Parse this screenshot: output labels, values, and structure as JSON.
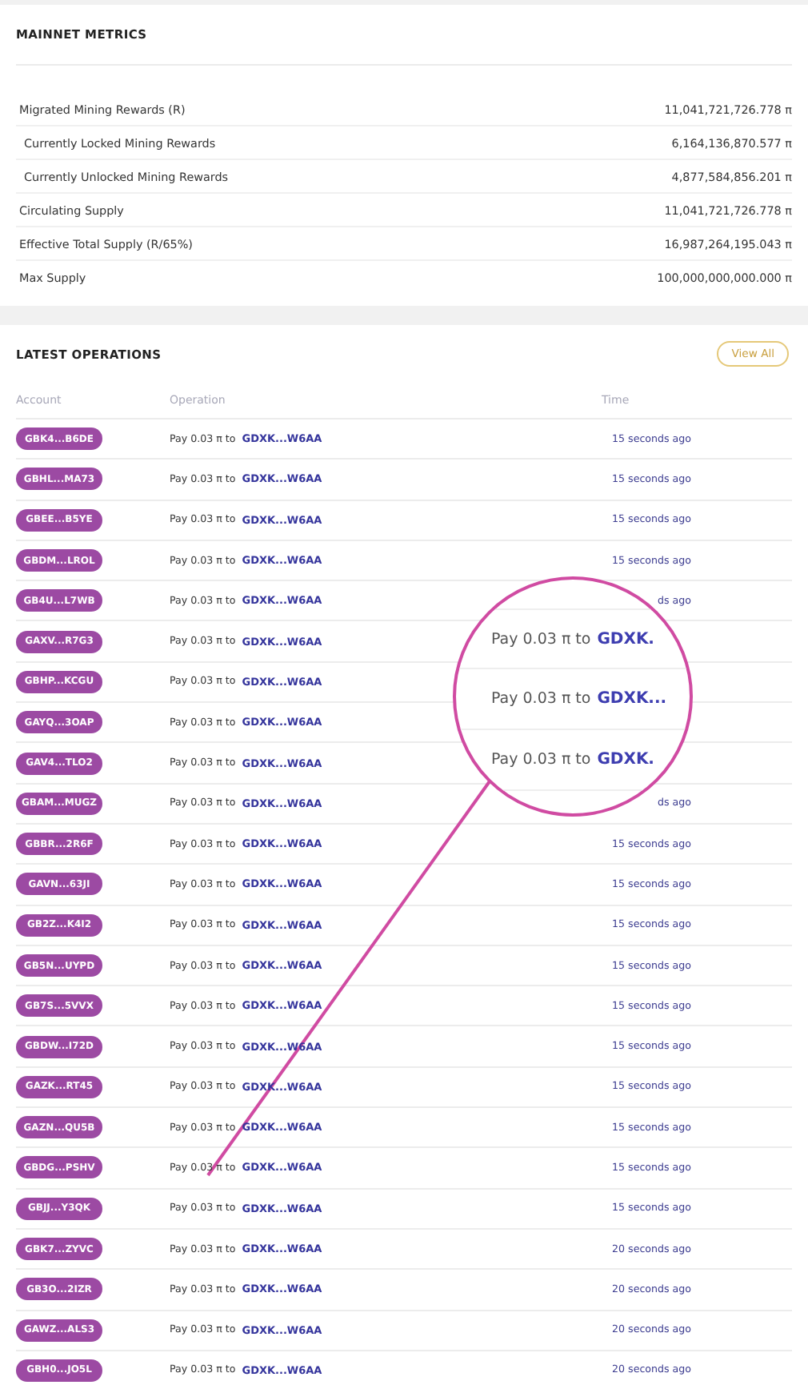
{
  "metrics": {
    "title": "MAINNET METRICS",
    "rows": [
      {
        "kind": "main",
        "label": "Migrated Mining Rewards (R)",
        "value": "11,041,721,726.778 π"
      },
      {
        "kind": "sub",
        "label": "Currently Locked Mining Rewards",
        "value": "6,164,136,870.577 π"
      },
      {
        "kind": "sub",
        "label": "Currently Unlocked Mining Rewards",
        "value": "4,877,584,856.201 π"
      },
      {
        "kind": "main",
        "label": "Circulating Supply",
        "value": "11,041,721,726.778 π"
      },
      {
        "kind": "main",
        "label": "Effective Total Supply (R/65%)",
        "value": "16,987,264,195.043 π"
      },
      {
        "kind": "main",
        "label": "Max Supply",
        "value": "100,000,000,000.000 π"
      }
    ]
  },
  "operations": {
    "title": "LATEST OPERATIONS",
    "view_all": "View All",
    "columns": [
      "Account",
      "Operation",
      "Time"
    ],
    "rows": [
      {
        "account": "GBK4...B6DE",
        "text": "Pay 0.03 π to",
        "link": "GDXK...W6AA",
        "time": "15 seconds ago"
      },
      {
        "account": "GBHL...MA73",
        "text": "Pay 0.03 π to",
        "link": "GDXK...W6AA",
        "time": "15 seconds ago"
      },
      {
        "account": "GBEE...B5YE",
        "text": "Pay 0.03 π to",
        "link": "GDXK...W6AA",
        "time": "15 seconds ago"
      },
      {
        "account": "GBDM...LROL",
        "text": "Pay 0.03 π to",
        "link": "GDXK...W6AA",
        "time": "15 seconds ago"
      },
      {
        "account": "GB4U...L7WB",
        "text": "Pay 0.03 π to",
        "link": "GDXK...W6AA",
        "time": "ds ago"
      },
      {
        "account": "GAXV...R7G3",
        "text": "Pay 0.03 π to",
        "link": "GDXK...W6AA"
      },
      {
        "account": "GBHP...KCGU",
        "text": "Pay 0.03 π to",
        "link": "GDXK...W6AA"
      },
      {
        "account": "GAYQ...3OAP",
        "text": "Pay 0.03 π to",
        "link": "GDXK...W6AA"
      },
      {
        "account": "GAV4...TLO2",
        "text": "Pay 0.03 π to",
        "link": "GDXK...W6AA"
      },
      {
        "account": "GBAM...MUGZ",
        "text": "Pay 0.03 π to",
        "link": "GDXK...W6AA",
        "time": "ds ago"
      },
      {
        "account": "GBBR...2R6F",
        "text": "Pay 0.03 π to",
        "link": "GDXK...W6AA",
        "time": "15 seconds ago"
      },
      {
        "account": "GAVN...63JI",
        "text": "Pay 0.03 π to",
        "link": "GDXK...W6AA",
        "time": "15 seconds ago"
      },
      {
        "account": "GB2Z...K4I2",
        "text": "Pay 0.03 π to",
        "link": "GDXK...W6AA",
        "time": "15 seconds ago"
      },
      {
        "account": "GB5N...UYPD",
        "text": "Pay 0.03 π to",
        "link": "GDXK...W6AA",
        "time": "15 seconds ago"
      },
      {
        "account": "GB7S...5VVX",
        "text": "Pay 0.03 π to",
        "link": "GDXK...W6AA",
        "time": "15 seconds ago"
      },
      {
        "account": "GBDW...I72D",
        "text": "Pay 0.03 π to",
        "link": "GDXK...W6AA",
        "time": "15 seconds ago"
      },
      {
        "account": "GAZK...RT45",
        "text": "Pay 0.03 π to",
        "link": "GDXK...W6AA",
        "time": "15 seconds ago"
      },
      {
        "account": "GAZN...QU5B",
        "text": "Pay 0.03 π to",
        "link": "GDXK...W6AA",
        "time": "15 seconds ago"
      },
      {
        "account": "GBDG...PSHV",
        "text": "Pay 0.03 π to",
        "link": "GDXK...W6AA",
        "time": "15 seconds ago"
      },
      {
        "account": "GBJJ...Y3QK",
        "text": "Pay 0.03 π to",
        "link": "GDXK...W6AA",
        "time": "15 seconds ago"
      },
      {
        "account": "GBK7...ZYVC",
        "text": "Pay 0.03 π to",
        "link": "GDXK...W6AA",
        "time": "20 seconds ago"
      },
      {
        "account": "GB3O...2IZR",
        "text": "Pay 0.03 π to",
        "link": "GDXK...W6AA",
        "time": "20 seconds ago"
      },
      {
        "account": "GAWZ...ALS3",
        "text": "Pay 0.03 π to",
        "link": "GDXK...W6AA",
        "time": "20 seconds ago"
      },
      {
        "account": "GBH0...JO5L",
        "text": "Pay 0.03 π to",
        "link": "GDXK...W6AA",
        "time": "20 seconds ago"
      }
    ]
  },
  "magnifier": {
    "lines": [
      {
        "text": "Pay 0.03 π to",
        "link": "GDXK."
      },
      {
        "text": "Pay 0.03 π to",
        "link": "GDXK..."
      },
      {
        "text": "Pay 0.03 π to",
        "link": "GDXK."
      }
    ]
  }
}
